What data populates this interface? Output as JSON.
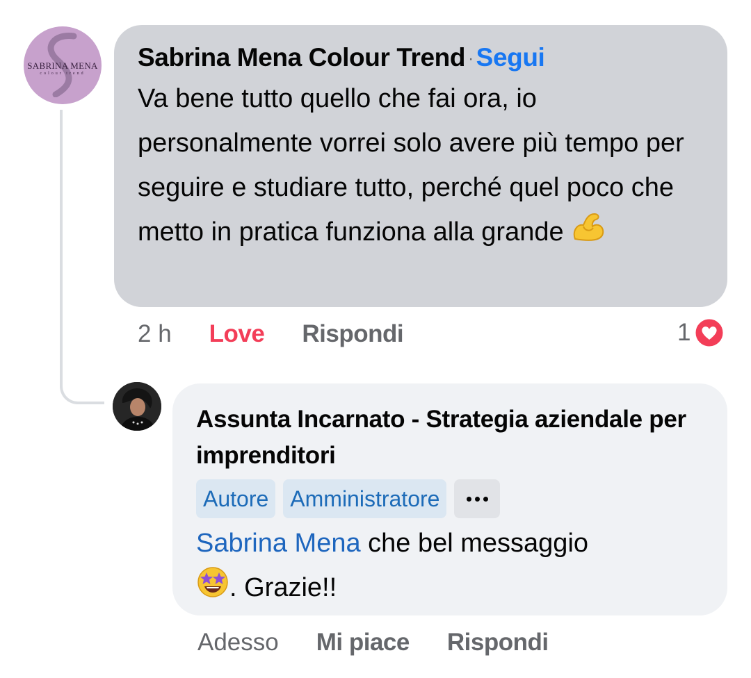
{
  "comment": {
    "avatar_text": "SABRINA MENA",
    "avatar_subtext": "colour trend",
    "author": "Sabrina Mena Colour Trend",
    "separator": "·",
    "follow_label": "Segui",
    "text": "Va bene tutto quello che fai ora, io personalmente vorrei solo avere più tempo per seguire e studiare tutto, perché quel poco che metto in pratica funziona alla grande",
    "emoji": "flexed-biceps",
    "time": "2 h",
    "reaction_label": "Love",
    "reply_label": "Rispondi",
    "reaction_count": "1",
    "reaction_icon": "heart-reaction-icon",
    "colors": {
      "love": "#f33e58",
      "follow": "#1877f2",
      "bubble": "#d1d3d8"
    }
  },
  "reply": {
    "author": "Assunta Incarnato - Strategia aziendale per imprenditori",
    "badges": [
      "Autore",
      "Amministratore"
    ],
    "more_icon": "more-options-icon",
    "mention": "Sabrina Mena",
    "text_after_mention": "che bel messaggio",
    "emoji": "star-struck",
    "text_end": ". Grazie!!",
    "time": "Adesso",
    "like_label": "Mi piace",
    "reply_label": "Rispondi",
    "colors": {
      "mention": "#1e66be",
      "badge_bg": "#dbe7f2",
      "bubble": "#f0f2f5"
    }
  }
}
